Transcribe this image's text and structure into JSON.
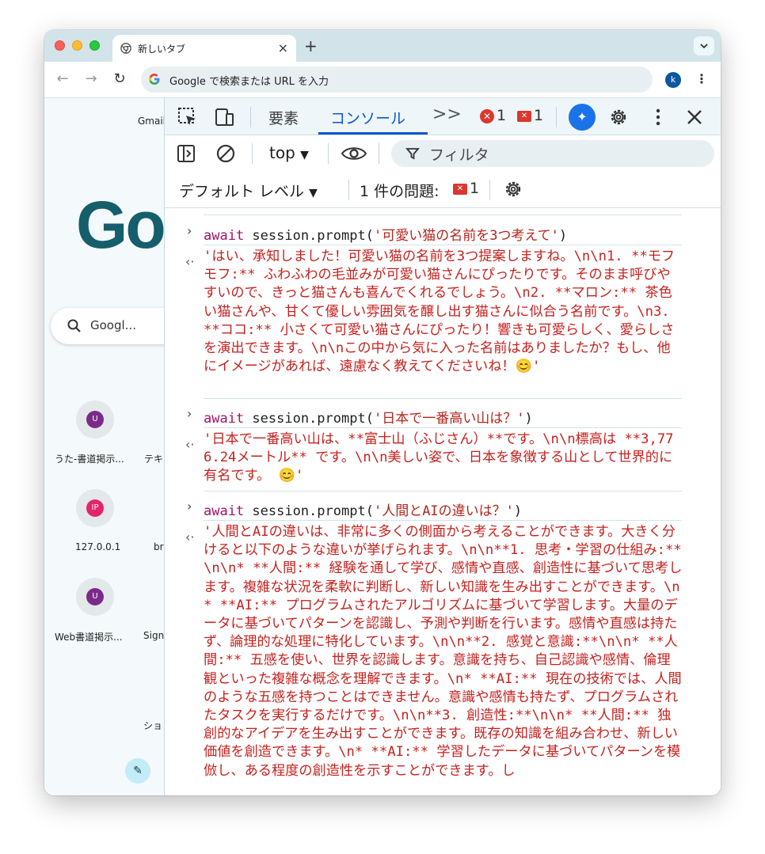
{
  "browser": {
    "tab_title": "新しいタブ",
    "new_tab_symbol": "+",
    "omnibox_text": "Google で検索または URL を入力",
    "profile_initial": "k"
  },
  "newtab_page": {
    "gmail_link": "Gmail",
    "logo_text": "Go",
    "search_placeholder": "Googl...",
    "shortcuts": [
      {
        "initial": "U",
        "label": "うた-書道掲示...",
        "color": "#7b2a8a"
      },
      {
        "initial": "IP",
        "label": "127.0.0.1",
        "color": "#e3256b"
      },
      {
        "initial": "U",
        "label": "Web書道掲示...",
        "color": "#7b2a8a"
      }
    ],
    "partial_labels": [
      "テキ",
      "br",
      "Sign",
      "ショ"
    ]
  },
  "devtools": {
    "tabs": {
      "elements": "要素",
      "console": "コンソール",
      "more": ">>"
    },
    "error_count": "1",
    "issue_count": "1",
    "context": "top",
    "filter_placeholder": "フィルタ",
    "default_levels": "デフォルト レベル",
    "issues_label": "1 件の問題:",
    "issues_badge_count": "1"
  },
  "console": {
    "entries": [
      {
        "keyword": "await",
        "call": " session.prompt(",
        "arg": "'可愛い猫の名前を3つ考えて'",
        "close": ")",
        "result": "'はい、承知しました！可愛い猫の名前を3つ提案しますね。\\n\\n1. **モフモフ:** ふわふわの毛並みが可愛い猫さんにぴったりです。そのまま呼びやすいので、きっと猫さんも喜んでくれるでしょう。\\n2. **マロン:** 茶色い猫さんや、甘くて優しい雰囲気を醸し出す猫さんに似合う名前です。\\n3. **ココ:** 小さくて可愛い猫さんにぴったり！響きも可愛らしく、愛らしさを演出できます。\\n\\nこの中から気に入った名前はありましたか？もし、他にイメージがあれば、遠慮なく教えてくださいね！😊'"
      },
      {
        "keyword": "await",
        "call": " session.prompt(",
        "arg": "'日本で一番高い山は？'",
        "close": ")",
        "result": "'日本で一番高い山は、**富士山（ふじさん）**です。\\n\\n標高は **3,776.24メートル** です。\\n\\n美しい姿で、日本を象徴する山として世界的に有名です。 😊'"
      },
      {
        "keyword": "await",
        "call": " session.prompt(",
        "arg": "'人間とAIの違いは？'",
        "close": ")",
        "result": "'人間とAIの違いは、非常に多くの側面から考えることができます。大きく分けると以下のような違いが挙げられます。\\n\\n**1. 思考・学習の仕組み:**\\n\\n* **人間:** 経験を通して学び、感情や直感、創造性に基づいて思考します。複雑な状況を柔軟に判断し、新しい知識を生み出すことができます。\\n* **AI:** プログラムされたアルゴリズムに基づいて学習します。大量のデータに基づいてパターンを認識し、予測や判断を行います。感情や直感は持たず、論理的な処理に特化しています。\\n\\n**2. 感覚と意識:**\\n\\n* **人間:** 五感を使い、世界を認識します。意識を持ち、自己認識や感情、倫理観といった複雑な概念を理解できます。\\n* **AI:** 現在の技術では、人間のような五感を持つことはできません。意識や感情も持たず、プログラムされたタスクを実行するだけです。\\n\\n**3. 創造性:**\\n\\n* **人間:** 独創的なアイデアを生み出すことができます。既存の知識を組み合わせ、新しい価値を創造できます。\\n* **AI:** 学習したデータに基づいてパターンを模倣し、ある程度の創造性を示すことができます。し"
      }
    ]
  }
}
